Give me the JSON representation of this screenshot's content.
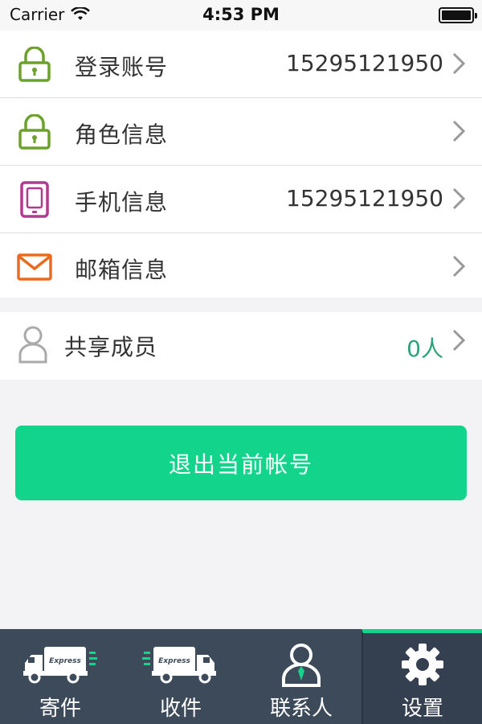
{
  "status_bar": {
    "carrier": "Carrier",
    "time": "4:53 PM",
    "icons": [
      "wifi-icon",
      "battery-icon"
    ]
  },
  "account_rows": [
    {
      "label": "登录账号",
      "value": "15295121950",
      "icon": "lock-icon",
      "icon_color": "#6ca12c"
    },
    {
      "label": "角色信息",
      "value": "",
      "icon": "lock-icon",
      "icon_color": "#6ca12c"
    },
    {
      "label": "手机信息",
      "value": "15295121950",
      "icon": "phone-icon",
      "icon_color": "#b23a8f"
    },
    {
      "label": "邮箱信息",
      "value": "",
      "icon": "mail-icon",
      "icon_color": "#ec6a1f"
    }
  ],
  "member_row": {
    "label": "共享成员",
    "value": "0人",
    "icon": "person-icon",
    "value_color": "#2aa478"
  },
  "logout_button": {
    "label": "退出当前帐号",
    "color": "#12d48b"
  },
  "tab_bar": {
    "active_indicator_color": "#12d48b",
    "tabs": [
      {
        "label": "寄件",
        "icon": "send-truck-icon",
        "active": false
      },
      {
        "label": "收件",
        "icon": "receive-truck-icon",
        "active": false
      },
      {
        "label": "联系人",
        "icon": "contact-icon",
        "active": false
      },
      {
        "label": "设置",
        "icon": "gear-icon",
        "active": true
      }
    ],
    "truck_text": "Express"
  }
}
